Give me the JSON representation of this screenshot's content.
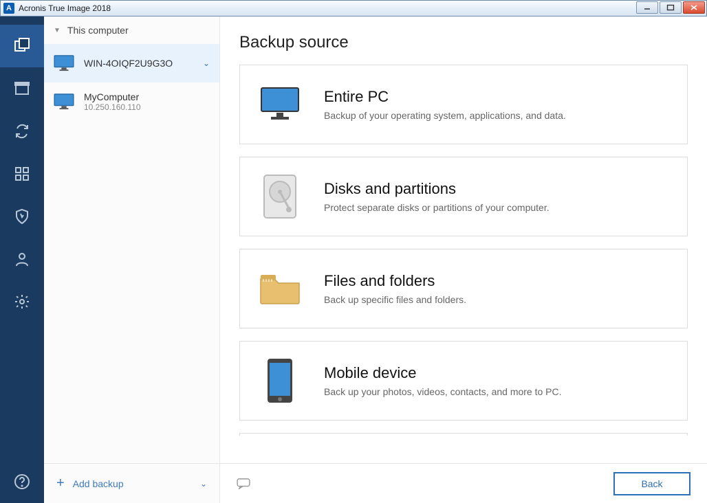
{
  "window": {
    "title": "Acronis True Image 2018",
    "app_icon_letter": "A"
  },
  "side": {
    "header": "This computer",
    "computers": [
      {
        "name": "WIN-4OIQF2U9G3O",
        "ip": "",
        "selected": true
      },
      {
        "name": "MyComputer",
        "ip": "10.250.160.110",
        "selected": false
      }
    ],
    "add_backup": "Add backup"
  },
  "main": {
    "title": "Backup source",
    "options": [
      {
        "title": "Entire PC",
        "desc": "Backup of your operating system, applications, and data.",
        "icon": "monitor"
      },
      {
        "title": "Disks and partitions",
        "desc": "Protect separate disks or partitions of your computer.",
        "icon": "hdd"
      },
      {
        "title": "Files and folders",
        "desc": "Back up specific files and folders.",
        "icon": "folder"
      },
      {
        "title": "Mobile device",
        "desc": "Back up your photos, videos, contacts, and more to PC.",
        "icon": "phone"
      }
    ],
    "back_label": "Back"
  }
}
